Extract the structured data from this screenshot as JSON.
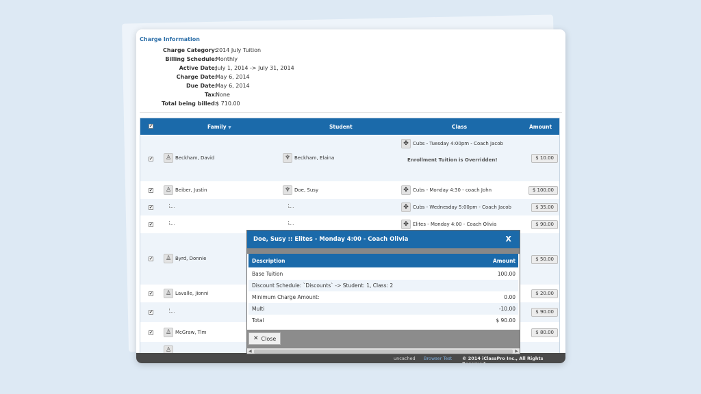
{
  "charge": {
    "title": "Charge Information",
    "fields": [
      {
        "label": "Charge Category:",
        "value": "2014 July Tuition"
      },
      {
        "label": "Billing Schedule:",
        "value": "Monthly"
      },
      {
        "label": "Active Date:",
        "value": "July 1, 2014 -> July 31, 2014"
      },
      {
        "label": "Charge Date:",
        "value": "May 6, 2014"
      },
      {
        "label": "Due Date:",
        "value": "May 6, 2014"
      },
      {
        "label": "Tax:",
        "value": "None"
      },
      {
        "label": "Total being billed:",
        "value": "$ 710.00"
      }
    ]
  },
  "table": {
    "header_check": "✔",
    "columns": {
      "family": "Family",
      "student": "Student",
      "class": "Class",
      "amount": "Amount"
    },
    "sort_icon": "▼",
    "override_text": "Enrollment Tuition is Overridden!",
    "rows": [
      {
        "family": "Beckham, David",
        "student": "Beckham, Elaina",
        "class": "Cubs - Tuesday 4:00pm - Coach Jacob",
        "amount": "$ 10.00"
      },
      {
        "family": "Beiber, Justin",
        "student": "Doe, Susy",
        "class": "Cubs - Monday 4:30 - coach John",
        "amount": "$ 100.00"
      },
      {
        "family": "",
        "student": "",
        "class": "Cubs - Wednesday 5:00pm - Coach Jacob",
        "amount": "$ 35.00"
      },
      {
        "family": "",
        "student": "",
        "class": "Elites - Monday 4:00 - Coach Olivia",
        "amount": "$ 90.00"
      },
      {
        "family": "Byrd, Donnie",
        "student": "",
        "class": "",
        "amount": "$ 50.00"
      },
      {
        "family": "Lavalle, Jionni",
        "student": "",
        "class": "",
        "amount": "$ 20.00"
      },
      {
        "family": "",
        "student": "",
        "class": "",
        "amount": "$ 90.00"
      },
      {
        "family": "McGraw, Tim",
        "student": "",
        "class": "",
        "amount": "$ 80.00"
      }
    ]
  },
  "modal": {
    "title": "Doe, Susy :: Elites - Monday 4:00 - Coach Olivia",
    "close_x": "X",
    "col_description": "Description",
    "col_amount": "Amount",
    "rows": [
      {
        "description": "Base Tuition",
        "amount": "100.00"
      },
      {
        "description": "Discount Schedule: `Discounts` -> Student: 1, Class: 2",
        "amount": ""
      },
      {
        "description": "Minimum Charge Amount:",
        "amount": "0.00"
      },
      {
        "description": "Multi",
        "amount": "-10.00"
      },
      {
        "description": "Total",
        "amount": "$ 90.00"
      }
    ],
    "close_label": "Close"
  },
  "footer": {
    "status": "uncached",
    "link": "Browser Test",
    "copyright": "© 2014 iClassPro Inc., All Rights Reserved."
  },
  "icons": {
    "family": "family-icon",
    "student": "student-icon",
    "class": "class-icon"
  },
  "colors": {
    "header": "#1b6aaa",
    "title": "#2d6fa8",
    "background": "#dde9f4"
  }
}
